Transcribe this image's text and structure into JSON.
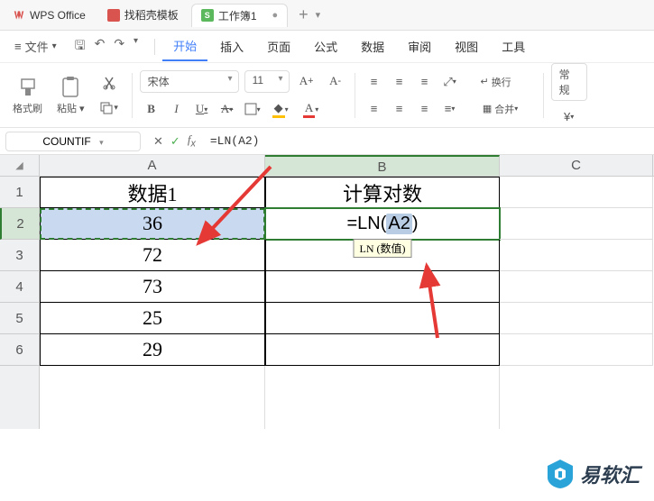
{
  "titlebar": {
    "tabs": [
      {
        "label": "WPS Office"
      },
      {
        "label": "找稻壳模板"
      },
      {
        "label": "工作簿1"
      }
    ]
  },
  "menubar": {
    "file_label": "文件",
    "items": [
      "开始",
      "插入",
      "页面",
      "公式",
      "数据",
      "审阅",
      "视图",
      "工具"
    ],
    "active_index": 0
  },
  "toolbar": {
    "format_brush": "格式刷",
    "paste": "粘贴",
    "font_name": "宋体",
    "font_size": "11",
    "wrap": "换行",
    "merge": "合并",
    "style": "常规"
  },
  "formula_bar": {
    "namebox": "COUNTIF",
    "formula": "=LN(A2)"
  },
  "sheet": {
    "columns": [
      "A",
      "B",
      "C"
    ],
    "rows": [
      {
        "n": "1",
        "a": "数据1",
        "b": "计算对数"
      },
      {
        "n": "2",
        "a": "36",
        "b_prefix": "=LN(",
        "b_ref": "A2",
        "b_suffix": ")"
      },
      {
        "n": "3",
        "a": "72",
        "b": ""
      },
      {
        "n": "4",
        "a": "73",
        "b": ""
      },
      {
        "n": "5",
        "a": "25",
        "b": ""
      },
      {
        "n": "6",
        "a": "29",
        "b": ""
      }
    ],
    "tooltip": "LN (数值)"
  },
  "watermark": {
    "text": "易软汇"
  }
}
